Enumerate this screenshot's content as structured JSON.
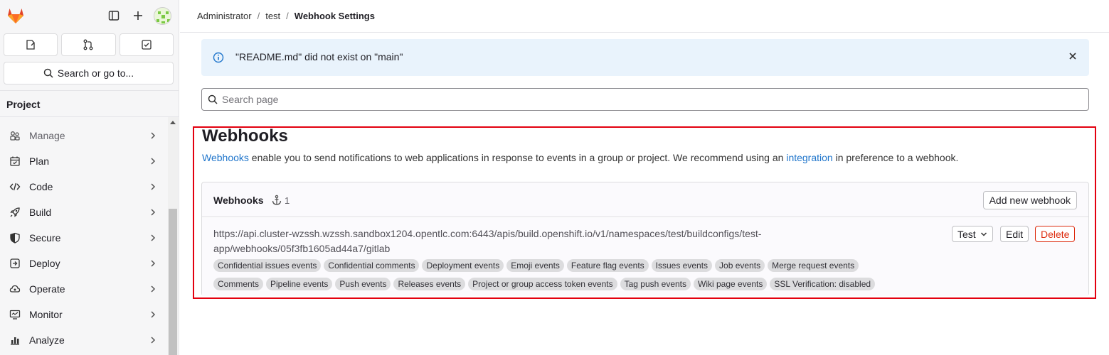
{
  "sidebar": {
    "search_label": "Search or go to...",
    "section_label": "Project",
    "items": [
      {
        "label": "Manage",
        "icon": "users-icon"
      },
      {
        "label": "Plan",
        "icon": "calendar-icon"
      },
      {
        "label": "Code",
        "icon": "code-icon"
      },
      {
        "label": "Build",
        "icon": "rocket-icon"
      },
      {
        "label": "Secure",
        "icon": "shield-icon"
      },
      {
        "label": "Deploy",
        "icon": "deploy-icon"
      },
      {
        "label": "Operate",
        "icon": "cloud-gear-icon"
      },
      {
        "label": "Monitor",
        "icon": "monitor-icon"
      },
      {
        "label": "Analyze",
        "icon": "chart-icon"
      }
    ]
  },
  "breadcrumb": [
    "Administrator",
    "test",
    "Webhook Settings"
  ],
  "alert": {
    "text": "\"README.md\" did not exist on \"main\""
  },
  "search_page": {
    "placeholder": "Search page"
  },
  "webhooks": {
    "title": "Webhooks",
    "desc_link1": "Webhooks",
    "desc_mid": " enable you to send notifications to web applications in response to events in a group or project. We recommend using an ",
    "desc_link2": "integration",
    "desc_end": " in preference to a webhook.",
    "card_title": "Webhooks",
    "count": "1",
    "add_label": "Add new webhook",
    "hook": {
      "url": "https://api.cluster-wzssh.wzssh.sandbox1204.opentlc.com:6443/apis/build.openshift.io/v1/namespaces/test/buildconfigs/test-app/webhooks/05f3fb1605ad44a7/gitlab",
      "tags_row1": [
        "Confidential issues events",
        "Confidential comments",
        "Deployment events",
        "Emoji events",
        "Feature flag events",
        "Issues events",
        "Job events",
        "Merge request events"
      ],
      "tags_row2": [
        "Comments",
        "Pipeline events",
        "Push events",
        "Releases events",
        "Project or group access token events",
        "Tag push events",
        "Wiki page events",
        "SSL Verification: disabled"
      ],
      "test_label": "Test",
      "edit_label": "Edit",
      "delete_label": "Delete"
    }
  },
  "colors": {
    "accent": "#1f75cb",
    "danger": "#dd2b0e",
    "highlight": "#e3000f"
  }
}
